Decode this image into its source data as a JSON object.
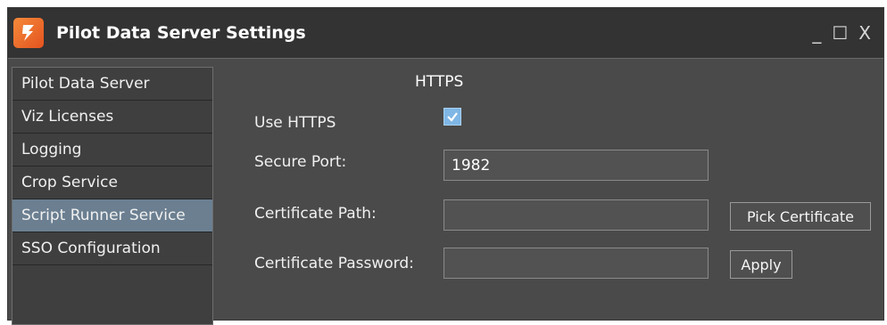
{
  "window": {
    "title": "Pilot Data Server Settings",
    "minimize": "_",
    "maximize": "☐",
    "close": "X"
  },
  "sidebar": {
    "items": [
      {
        "label": "Pilot Data Server"
      },
      {
        "label": "Viz Licenses"
      },
      {
        "label": "Logging"
      },
      {
        "label": "Crop Service"
      },
      {
        "label": "Script Runner Service",
        "selected": true
      },
      {
        "label": "SSO Configuration"
      }
    ]
  },
  "main": {
    "heading": "HTTPS",
    "use_https": {
      "label": "Use HTTPS",
      "checked": true
    },
    "secure_port": {
      "label": "Secure Port:",
      "value": "1982"
    },
    "certificate_path": {
      "label": "Certificate Path:",
      "value": "",
      "button": "Pick Certificate"
    },
    "certificate_password": {
      "label": "Certificate Password:",
      "value": "",
      "button": "Apply"
    }
  }
}
